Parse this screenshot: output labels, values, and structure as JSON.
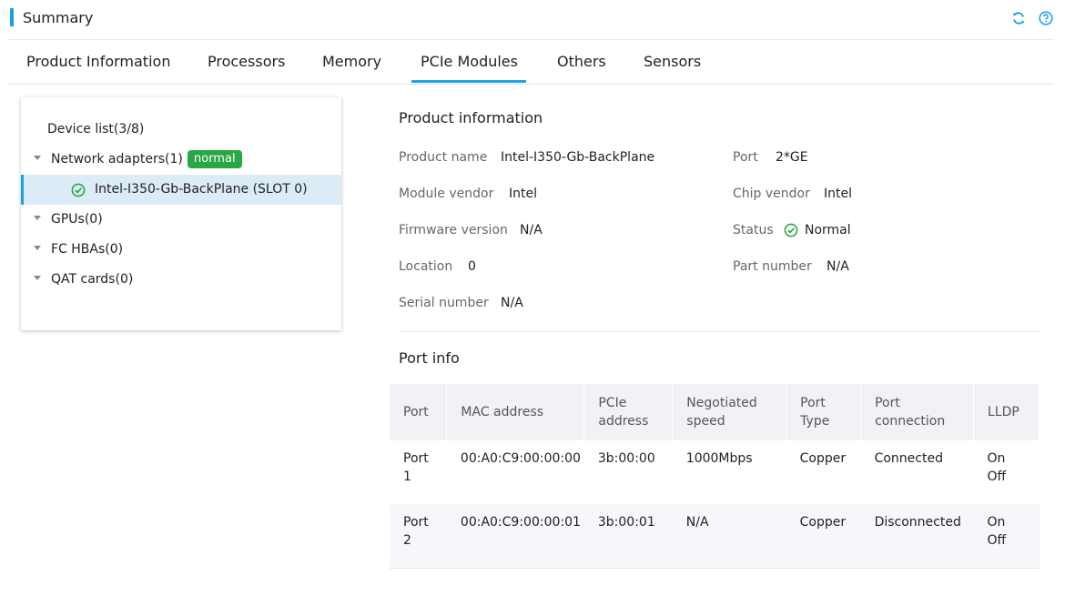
{
  "header": {
    "title": "Summary",
    "accent": "#1a9fe0",
    "icons": [
      "refresh-icon",
      "help-icon"
    ]
  },
  "tabs": [
    {
      "label": "Product Information"
    },
    {
      "label": "Processors"
    },
    {
      "label": "Memory"
    },
    {
      "label": "PCIe Modules",
      "active": true
    },
    {
      "label": "Others"
    },
    {
      "label": "Sensors"
    }
  ],
  "tree": {
    "root_label": "Device list(3/8)",
    "network": {
      "label": "Network adapters(1)",
      "badge": "normal",
      "badge_color": "#28a745"
    },
    "selected_item": "Intel-I350-Gb-BackPlane (SLOT 0)",
    "gpus": "GPUs(0)",
    "fc": "FC HBAs(0)",
    "qat": "QAT cards(0)"
  },
  "product": {
    "title": "Product information",
    "product_name_label": "Product name",
    "product_name": "Intel-I350-Gb-BackPlane",
    "port_label": "Port",
    "port": "2*GE",
    "module_vendor_label": "Module vendor",
    "module_vendor": "Intel",
    "chip_vendor_label": "Chip vendor",
    "chip_vendor": "Intel",
    "firmware_label": "Firmware version",
    "firmware": "N/A",
    "status_label": "Status",
    "status": "Normal",
    "status_color": "#28a745",
    "location_label": "Location",
    "location": "0",
    "part_label": "Part number",
    "part": "N/A",
    "serial_label": "Serial number",
    "serial": "N/A"
  },
  "port_info": {
    "title": "Port info",
    "headers": {
      "port": "Port",
      "mac": "MAC address",
      "pcie_1": "PCIe",
      "pcie_2": "address",
      "speed_1": "Negotiated",
      "speed_2": "speed",
      "type_1": "Port",
      "type_2": "Type",
      "conn_1": "Port",
      "conn_2": "connection",
      "lldp": "LLDP"
    },
    "rows": [
      {
        "port_1": "Port",
        "port_2": "1",
        "mac": "00:A0:C9:00:00:00",
        "pcie": "3b:00:00",
        "speed": "1000Mbps",
        "type": "Copper",
        "conn": "Connected",
        "lldp_on": "On",
        "lldp_off": "Off"
      },
      {
        "port_1": "Port",
        "port_2": "2",
        "mac": "00:A0:C9:00:00:01",
        "pcie": "3b:00:01",
        "speed": "N/A",
        "type": "Copper",
        "conn": "Disconnected",
        "lldp_on": "On",
        "lldp_off": "Off"
      }
    ]
  }
}
